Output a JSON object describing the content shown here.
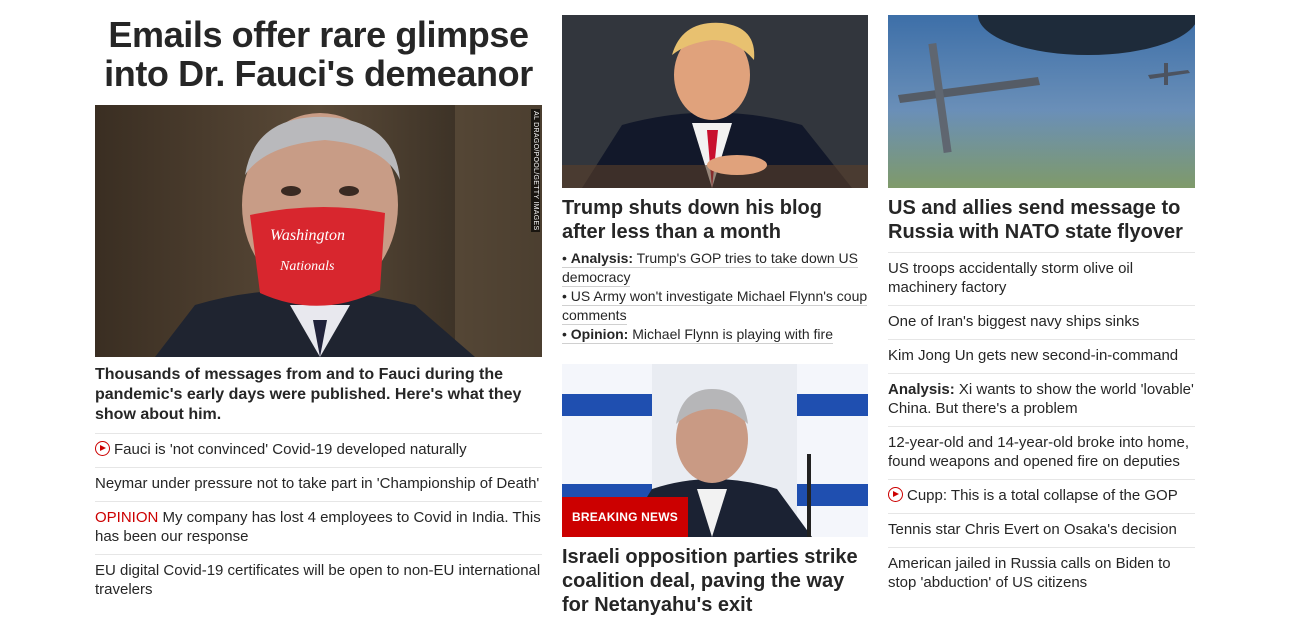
{
  "lead": {
    "headline": "Emails offer rare glimpse into Dr. Fauci's demeanor",
    "image_credit": "AL DRAGO/POOL/GETTY IMAGES",
    "description": "Thousands of messages from and to Fauci during the pandemic's early days were published. Here's what they show about him.",
    "items": [
      {
        "text": "Fauci is 'not convinced' Covid-19 developed naturally",
        "icon": "play-icon"
      },
      {
        "text": "Neymar under pressure not to take part in 'Championship of Death'"
      },
      {
        "label": "OPINION",
        "text": " My company has lost 4 employees to Covid in India. This has been our response"
      },
      {
        "text": "EU digital Covid-19 certificates will be open to non-EU international travelers"
      }
    ]
  },
  "middle": {
    "story1": {
      "title": "Trump shuts down his blog after less than a month",
      "links": [
        {
          "prefix": "• ",
          "label": "Analysis:",
          "text": " Trump's GOP tries to take down US democracy"
        },
        {
          "prefix": "• ",
          "text": "US Army won't investigate Michael Flynn's coup comments"
        },
        {
          "prefix": "• ",
          "label": "Opinion:",
          "text": " Michael Flynn is playing with fire"
        }
      ]
    },
    "story2": {
      "badge": "BREAKING NEWS",
      "title": "Israeli opposition parties strike coalition deal, paving the way for Netanyahu's exit"
    }
  },
  "right": {
    "title": "US and allies send message to Russia with NATO state flyover",
    "items": [
      {
        "text": "US troops accidentally storm olive oil machinery factory"
      },
      {
        "text": "One of Iran's biggest navy ships sinks"
      },
      {
        "text": "Kim Jong Un gets new second-in-command"
      },
      {
        "label": "Analysis:",
        "text": " Xi wants to show the world 'lovable' China. But there's a problem"
      },
      {
        "text": "12-year-old and 14-year-old broke into home, found weapons and opened fire on deputies"
      },
      {
        "text": "Cupp: This is a total collapse of the GOP",
        "icon": "play-icon"
      },
      {
        "text": "Tennis star Chris Evert on Osaka's decision"
      },
      {
        "text": "American jailed in Russia calls on Biden to stop 'abduction' of US citizens"
      }
    ]
  },
  "colors": {
    "accent": "#cc0000",
    "text": "#262626",
    "divider": "#e6e6e6"
  }
}
